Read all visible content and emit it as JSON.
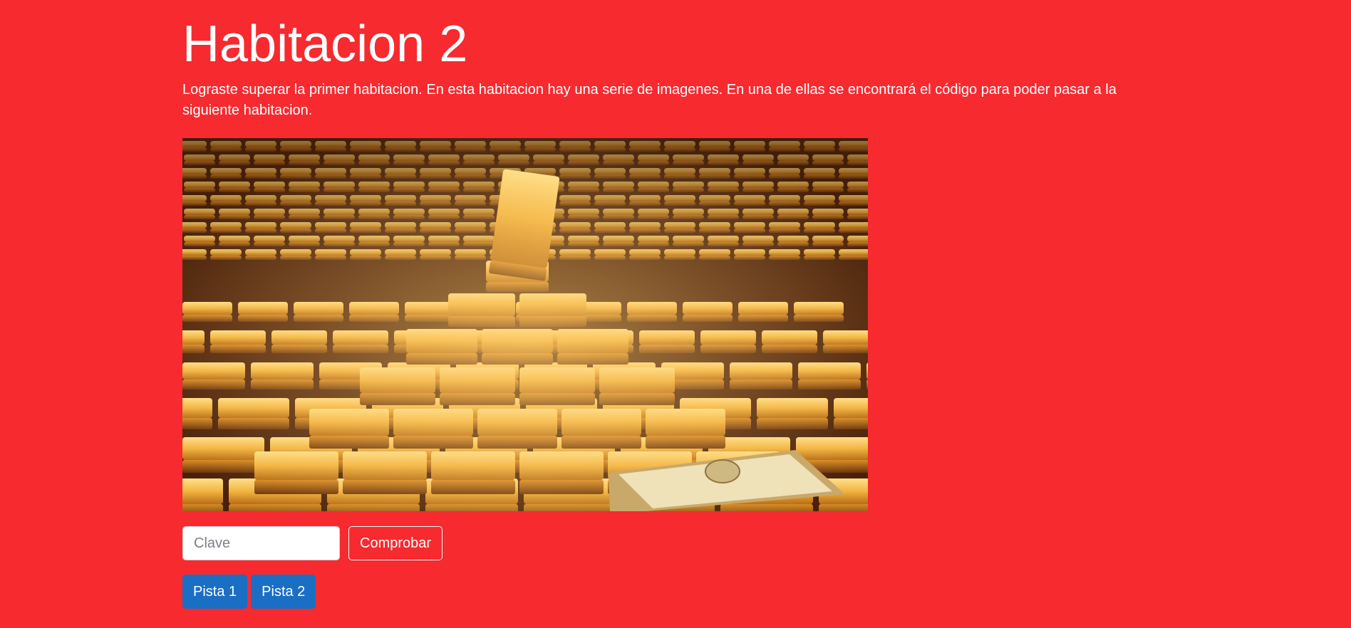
{
  "page": {
    "title": "Habitacion 2",
    "description": "Lograste superar la primer habitacion. En esta habitacion hay una serie de imagenes. En una de ellas se encontrará el código para poder pasar a la siguiente habitacion."
  },
  "image": {
    "subject": "gold bars vault"
  },
  "form": {
    "key_placeholder": "Clave",
    "key_value": "",
    "check_label": "Comprobar"
  },
  "hints": {
    "hint1_label": "Pista 1",
    "hint2_label": "Pista 2"
  },
  "colors": {
    "background": "#f62a2f",
    "primary_button": "#1a6fc4",
    "gold": "#e3a63a"
  }
}
